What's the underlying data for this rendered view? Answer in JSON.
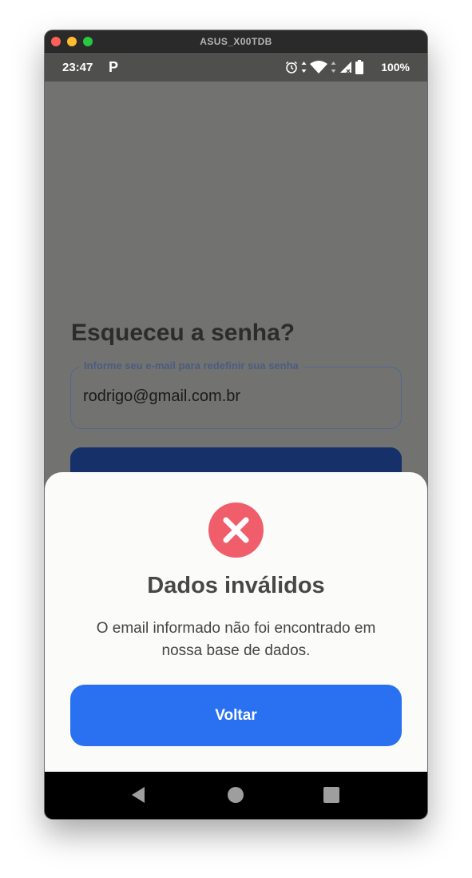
{
  "window": {
    "title": "ASUS_X00TDB"
  },
  "statusbar": {
    "time": "23:47",
    "app_icon": "P",
    "icons": [
      "alarm-icon",
      "data-arrows-icon",
      "wifi-icon",
      "signal-icon",
      "battery-icon"
    ],
    "battery": "100%"
  },
  "background_screen": {
    "title": "Esqueceu a senha?",
    "email_field": {
      "label": "Informe seu e-mail para redefinir sua senha",
      "value": "rodrigo@gmail.com.br"
    }
  },
  "dialog": {
    "icon": "error-x-icon",
    "title": "Dados inválidos",
    "message": "O email informado não foi encontrado em nossa base de dados.",
    "button_label": "Voltar"
  },
  "navbar": {
    "buttons": [
      "back-icon",
      "home-icon",
      "recents-icon"
    ]
  },
  "colors": {
    "primary_button": "#2a71f2",
    "error_icon": "#f05e6c",
    "dark_button": "#16316a",
    "overlay": "#727371"
  }
}
